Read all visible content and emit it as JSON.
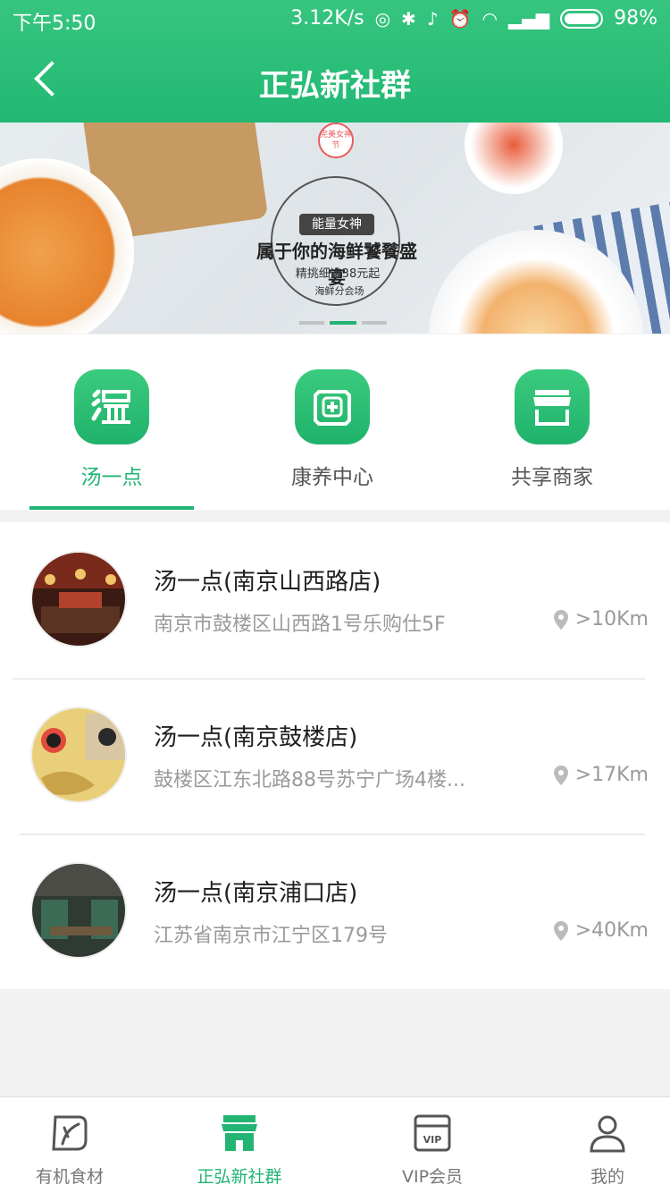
{
  "status_bar": {
    "time": "下午5:50",
    "network_speed": "3.12K/s",
    "battery": "98%"
  },
  "header": {
    "title": "正弘新社群"
  },
  "banner": {
    "badge_top": "能量女神",
    "headline": "属于你的海鲜饕餮盛宴",
    "subline": "精挑细选38元起",
    "tag": "海鲜分会场",
    "ribbon": "完美女神节",
    "active_dot": 1
  },
  "categories": [
    {
      "label": "汤一点",
      "icon": "tang-logo-icon",
      "active": true
    },
    {
      "label": "康养中心",
      "icon": "health-cross-icon",
      "active": false
    },
    {
      "label": "共享商家",
      "icon": "shop-awning-icon",
      "active": false
    }
  ],
  "stores": [
    {
      "name": "汤一点(南京山西路店)",
      "address": "南京市鼓楼区山西路1号乐购仕5F",
      "distance": ">10Km"
    },
    {
      "name": "汤一点(南京鼓楼店)",
      "address": "鼓楼区江东北路88号苏宁广场4楼...",
      "distance": ">17Km"
    },
    {
      "name": "汤一点(南京浦口店)",
      "address": "江苏省南京市江宁区179号",
      "distance": ">40Km"
    }
  ],
  "tabbar": [
    {
      "label": "有机食材",
      "icon": "leaf-icon",
      "active": false
    },
    {
      "label": "正弘新社群",
      "icon": "store-icon",
      "active": true
    },
    {
      "label": "VIP会员",
      "icon": "vip-card-icon",
      "active": false
    },
    {
      "label": "我的",
      "icon": "user-icon",
      "active": false
    }
  ],
  "colors": {
    "primary": "#22b473",
    "header_gradient_top": "#37c57f",
    "text_muted": "#9a9a9a"
  }
}
